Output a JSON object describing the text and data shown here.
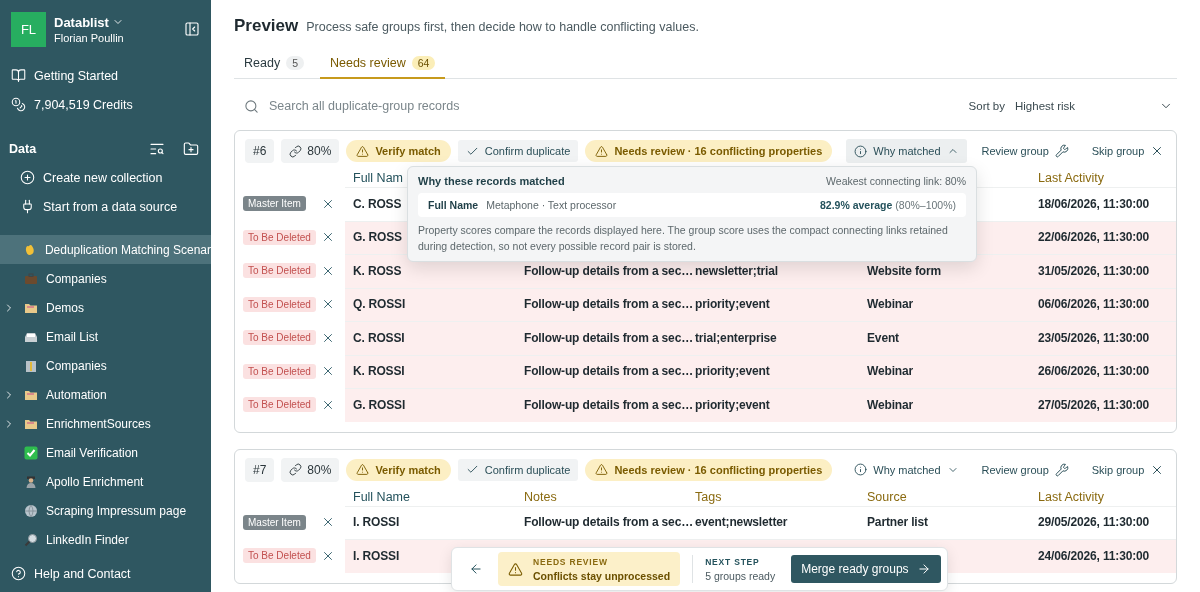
{
  "sidebar": {
    "avatar": "FL",
    "workspace": "Datablist",
    "user": "Florian Poullin",
    "links": [
      {
        "label": "Getting Started"
      },
      {
        "label": "7,904,519 Credits"
      }
    ],
    "section": "Data",
    "actions": [
      {
        "label": "Create new collection"
      },
      {
        "label": "Start from a data source"
      }
    ],
    "items": [
      {
        "label": "Deduplication Matching Scenar",
        "kind": "collection",
        "selected": true
      },
      {
        "label": "Companies",
        "kind": "collection",
        "selected": false
      },
      {
        "label": "Demos",
        "kind": "folder",
        "selected": false
      },
      {
        "label": "Email List",
        "kind": "collection",
        "selected": false
      },
      {
        "label": "Companies",
        "kind": "collection",
        "selected": false
      },
      {
        "label": "Automation",
        "kind": "folder",
        "selected": false
      },
      {
        "label": "EnrichmentSources",
        "kind": "folder",
        "selected": false
      },
      {
        "label": "Email Verification",
        "kind": "collection",
        "selected": false
      },
      {
        "label": "Apollo Enrichment",
        "kind": "collection",
        "selected": false
      },
      {
        "label": "Scraping Impressum page",
        "kind": "collection",
        "selected": false
      },
      {
        "label": "LinkedIn Finder",
        "kind": "collection",
        "selected": false
      }
    ],
    "footer": "Help and Contact"
  },
  "header": {
    "title": "Preview",
    "subtitle": "Process safe groups first, then decide how to handle conflicting values."
  },
  "tabs": [
    {
      "label": "Ready",
      "count": "5",
      "selected": false
    },
    {
      "label": "Needs review",
      "count": "64",
      "selected": true
    }
  ],
  "search": {
    "placeholder": "Search all duplicate-group records"
  },
  "sort": {
    "label": "Sort by",
    "value": "Highest risk"
  },
  "groups": [
    {
      "number": "#6",
      "score": "80%",
      "verify": "Verify match",
      "confirm": "Confirm duplicate",
      "review": "Needs review · 16 conflicting properties",
      "why": "Why matched",
      "expanded": true,
      "review_action": "Review group",
      "skip_action": "Skip group",
      "columns": {
        "full_name": {
          "label": "Full Nam",
          "conflict": false
        },
        "last_activity": {
          "label": "Last Activity",
          "conflict": true
        }
      },
      "popover": {
        "title": "Why these records matched",
        "weakest": "Weakest connecting link: 80%",
        "property": "Full Name",
        "method": "Metaphone · Text processor",
        "score": "**82.9% average** (80%–100%)",
        "note": "Property scores compare the records displayed here. The group score uses the compact connecting links retained during detection, so not every possible record pair is stored."
      },
      "rows": [
        {
          "kind": "master",
          "badge": "Master Item",
          "full_name": "C. ROSS",
          "last_activity": "18/06/2026, 11:30:00"
        },
        {
          "kind": "delete",
          "badge": "To Be Deleted",
          "full_name": "G. ROSS",
          "last_activity": "22/06/2026, 11:30:00"
        },
        {
          "kind": "delete",
          "badge": "To Be Deleted",
          "full_name": "K. ROSS",
          "notes": "Follow-up details from a sec…",
          "tags": "newsletter;trial",
          "source": "Website form",
          "last_activity": "31/05/2026, 11:30:00"
        },
        {
          "kind": "delete",
          "badge": "To Be Deleted",
          "full_name": "Q. ROSSI",
          "notes": "Follow-up details from a sec…",
          "tags": "priority;event",
          "source": "Webinar",
          "last_activity": "06/06/2026, 11:30:00"
        },
        {
          "kind": "delete",
          "badge": "To Be Deleted",
          "full_name": "C. ROSSI",
          "notes": "Follow-up details from a sec…",
          "tags": "trial;enterprise",
          "source": "Event",
          "last_activity": "23/05/2026, 11:30:00"
        },
        {
          "kind": "delete",
          "badge": "To Be Deleted",
          "full_name": "K. ROSSI",
          "notes": "Follow-up details from a sec…",
          "tags": "priority;event",
          "source": "Webinar",
          "last_activity": "26/06/2026, 11:30:00"
        },
        {
          "kind": "delete",
          "badge": "To Be Deleted",
          "full_name": "G. ROSSI",
          "notes": "Follow-up details from a sec…",
          "tags": "priority;event",
          "source": "Webinar",
          "last_activity": "27/05/2026, 11:30:00"
        }
      ]
    },
    {
      "number": "#7",
      "score": "80%",
      "verify": "Verify match",
      "confirm": "Confirm duplicate",
      "review": "Needs review · 16 conflicting properties",
      "why": "Why matched",
      "expanded": false,
      "review_action": "Review group",
      "skip_action": "Skip group",
      "columns": {
        "full_name": {
          "label": "Full Name",
          "conflict": false
        },
        "notes": {
          "label": "Notes",
          "conflict": true
        },
        "tags": {
          "label": "Tags",
          "conflict": true
        },
        "source": {
          "label": "Source",
          "conflict": true
        },
        "last_activity": {
          "label": "Last Activity",
          "conflict": true
        }
      },
      "rows": [
        {
          "kind": "master",
          "badge": "Master Item",
          "full_name": "I. ROSSI",
          "notes": "Follow-up details from a sec…",
          "tags": "event;newsletter",
          "source": "Partner list",
          "last_activity": "29/05/2026, 11:30:00"
        },
        {
          "kind": "delete",
          "badge": "To Be Deleted",
          "full_name": "I. ROSSI",
          "last_activity": "24/06/2026, 11:30:00"
        }
      ]
    }
  ],
  "bottom_bar": {
    "status_label": "NEEDS REVIEW",
    "status_text": "Conflicts stay unprocessed",
    "next_label": "NEXT STEP",
    "next_text": "5 groups ready",
    "action": "Merge ready groups"
  }
}
